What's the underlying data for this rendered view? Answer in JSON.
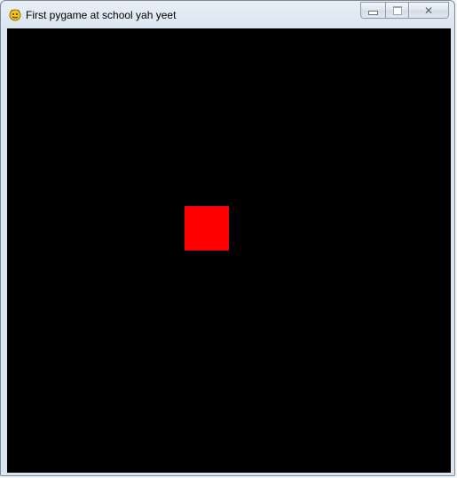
{
  "window": {
    "title": "First pygame at school yah yeet",
    "icon": "pygame-snake-icon",
    "controls": {
      "minimize_icon": "minimize-icon",
      "maximize_icon": "maximize-icon",
      "close_label": "✕"
    }
  },
  "game": {
    "background_color": "#000000",
    "player_color": "#ff0000"
  }
}
